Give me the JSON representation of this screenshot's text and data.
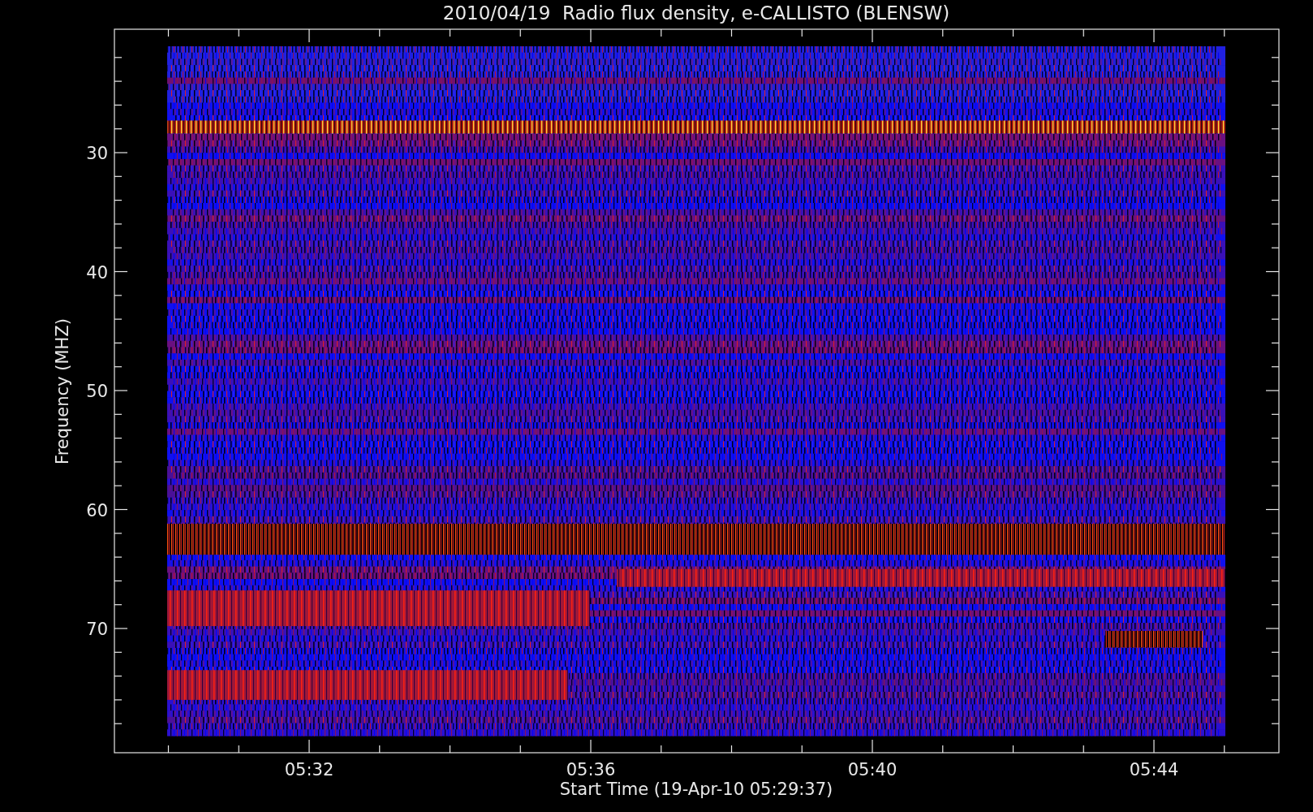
{
  "plot": {
    "title": "2010/04/19  Radio flux density, e-CALLISTO (BLENSW)",
    "ylabel": "Frequency (MHZ)",
    "xlabel": "Start Time (19-Apr-10 05:29:37)",
    "yticks": [
      "30",
      "40",
      "50",
      "60",
      "70"
    ],
    "xticks": [
      "05:32",
      "05:36",
      "05:40",
      "05:44"
    ]
  }
}
